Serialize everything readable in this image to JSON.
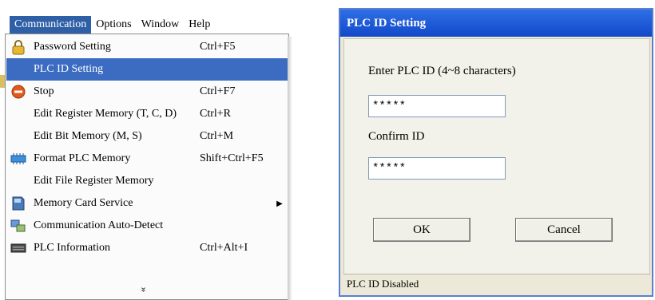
{
  "menubar": {
    "items": [
      "Communication",
      "Options",
      "Window",
      "Help"
    ]
  },
  "menu": {
    "items": [
      {
        "label": "Password Setting",
        "shortcut": "Ctrl+F5",
        "icon": "lock-icon"
      },
      {
        "label": "PLC ID Setting",
        "shortcut": "",
        "icon": ""
      },
      {
        "label": "Stop",
        "shortcut": "Ctrl+F7",
        "icon": "stop-icon"
      },
      {
        "label": "Edit Register Memory (T, C, D)",
        "shortcut": "Ctrl+R",
        "icon": ""
      },
      {
        "label": "Edit Bit Memory (M, S)",
        "shortcut": "Ctrl+M",
        "icon": ""
      },
      {
        "label": "Format PLC Memory",
        "shortcut": "Shift+Ctrl+F5",
        "icon": "format-memory-icon"
      },
      {
        "label": "Edit File Register Memory",
        "shortcut": "",
        "icon": ""
      },
      {
        "label": "Memory Card Service",
        "shortcut": "",
        "icon": "memory-card-icon"
      },
      {
        "label": "Communication Auto-Detect",
        "shortcut": "",
        "icon": "auto-detect-icon"
      },
      {
        "label": "PLC Information",
        "shortcut": "Ctrl+Alt+I",
        "icon": "plc-info-icon"
      }
    ],
    "more": "»"
  },
  "dialog": {
    "title": "PLC ID Setting",
    "enter_label": "Enter PLC ID (4~8 characters)",
    "enter_value": "*****",
    "confirm_label": "Confirm ID",
    "confirm_value": "*****",
    "ok": "OK",
    "cancel": "Cancel",
    "status": "PLC ID Disabled"
  }
}
